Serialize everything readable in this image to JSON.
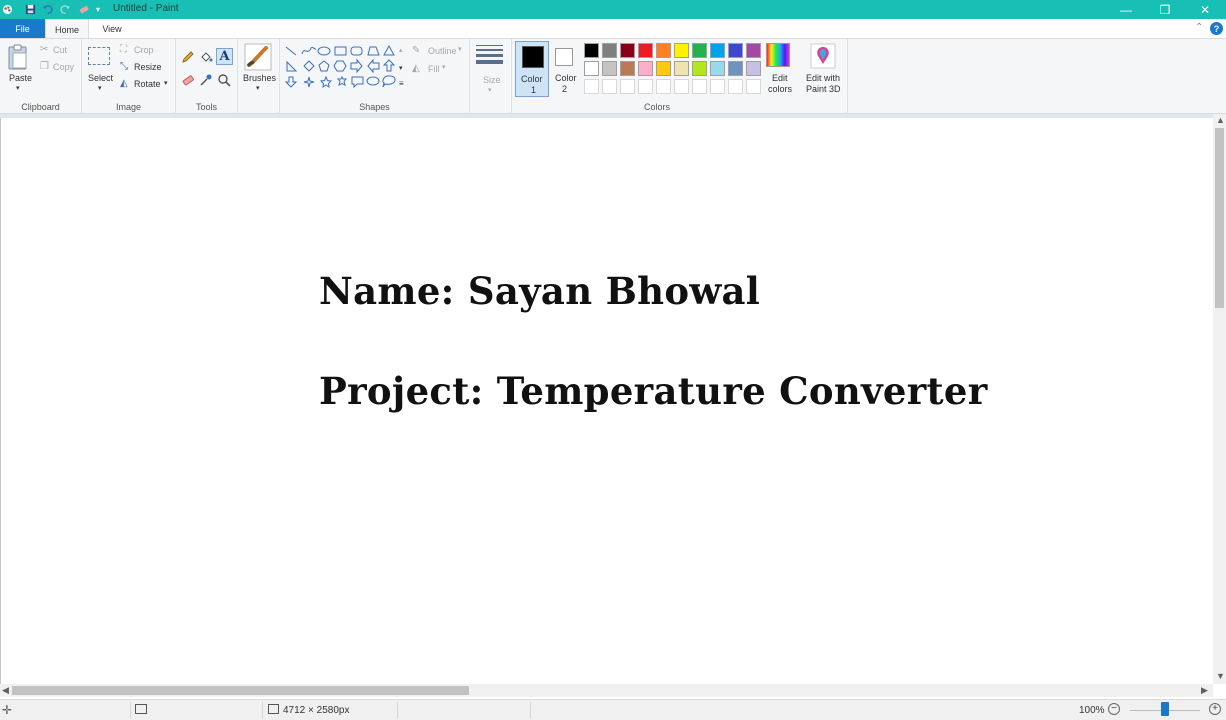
{
  "window": {
    "title": "Untitled - Paint"
  },
  "tabs": {
    "file": "File",
    "home": "Home",
    "view": "View"
  },
  "ribbon": {
    "clipboard": {
      "label": "Clipboard",
      "paste": "Paste",
      "cut": "Cut",
      "copy": "Copy"
    },
    "image": {
      "label": "Image",
      "select": "Select",
      "crop": "Crop",
      "resize": "Resize",
      "rotate": "Rotate"
    },
    "tools": {
      "label": "Tools"
    },
    "brushes": {
      "label": "Brushes"
    },
    "shapes": {
      "label": "Shapes",
      "outline": "Outline",
      "fill": "Fill"
    },
    "size": {
      "label": "Size"
    },
    "colors": {
      "label": "Colors",
      "color1": "Color",
      "color1_num": "1",
      "color2": "Color",
      "color2_num": "2",
      "color1_value": "#000000",
      "color2_value": "#ffffff",
      "edit_colors_1": "Edit",
      "edit_colors_2": "colors",
      "edit_paint3d_1": "Edit with",
      "edit_paint3d_2": "Paint 3D",
      "palette_row1": [
        "#000000",
        "#7f7f7f",
        "#880015",
        "#ed1c24",
        "#ff7f27",
        "#fff200",
        "#22b14c",
        "#00a2e8",
        "#3f48cc",
        "#a349a4"
      ],
      "palette_row2": [
        "#ffffff",
        "#c3c3c3",
        "#b97a57",
        "#ffaec9",
        "#ffc90e",
        "#efe4b0",
        "#b5e61d",
        "#99d9ea",
        "#7092be",
        "#c8bfe7"
      ]
    }
  },
  "canvas": {
    "line1": "Name: Sayan Bhowal",
    "line2": "Project: Temperature Converter"
  },
  "status": {
    "image_size": "4712 × 2580px",
    "zoom": "100%"
  },
  "accent_color": "#1979ca",
  "titlebar_color": "#17bfb5"
}
